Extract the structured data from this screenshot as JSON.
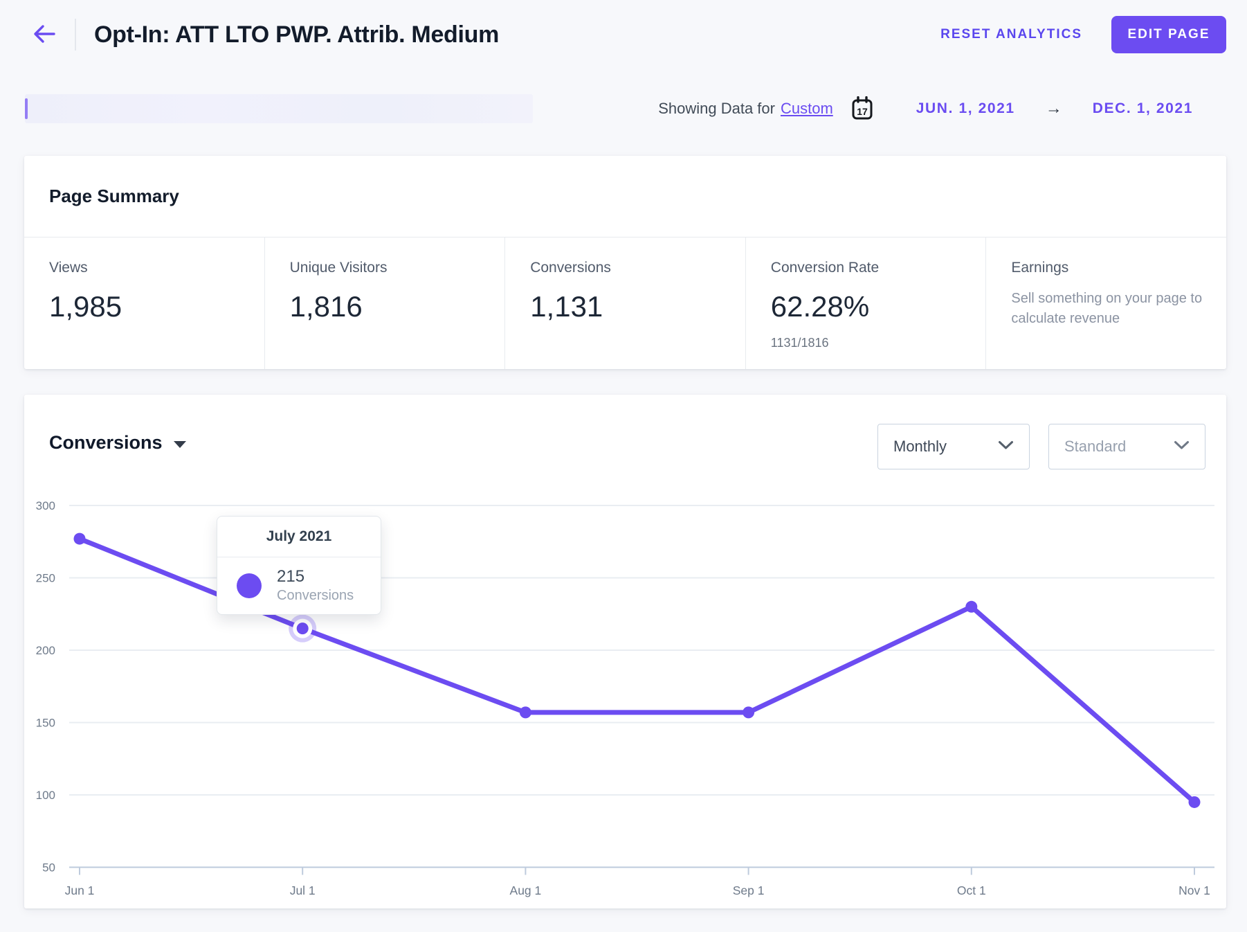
{
  "colors": {
    "accent": "#6C4CF1",
    "reset_link": "#5A46EE",
    "grid_line": "#e9edf2",
    "axis_line": "#becbdd",
    "axis_label": "#6e7a8a"
  },
  "header": {
    "title": "Opt-In: ATT LTO PWP. Attrib. Medium",
    "reset_label": "RESET ANALYTICS",
    "edit_label": "EDIT PAGE"
  },
  "date_bar": {
    "prefix": "Showing Data for",
    "mode_link": "Custom",
    "calendar_day": "17",
    "start_date": "JUN. 1, 2021",
    "arrow": "→",
    "end_date": "DEC. 1, 2021"
  },
  "page_summary": {
    "title": "Page Summary",
    "stats": [
      {
        "label": "Views",
        "value": "1,985"
      },
      {
        "label": "Unique Visitors",
        "value": "1,816"
      },
      {
        "label": "Conversions",
        "value": "1,131"
      },
      {
        "label": "Conversion Rate",
        "value": "62.28%",
        "sub": "1131/1816"
      },
      {
        "label": "Earnings",
        "description": "Sell something on your page to calculate revenue"
      }
    ]
  },
  "chart_section": {
    "title": "Conversions",
    "interval_dropdown": {
      "value": "Monthly"
    },
    "view_dropdown": {
      "value": "Standard"
    }
  },
  "tooltip": {
    "title": "July 2021",
    "value": "215",
    "label": "Conversions"
  },
  "chart_data": {
    "type": "line",
    "title": "Conversions",
    "categories": [
      "Jun 1",
      "Jul 1",
      "Aug 1",
      "Sep 1",
      "Oct 1",
      "Nov 1"
    ],
    "series": [
      {
        "name": "Conversions",
        "values": [
          277,
          215,
          157,
          157,
          230,
          95
        ]
      }
    ],
    "xlabel": "",
    "ylabel": "",
    "ylim": [
      50,
      300
    ],
    "yticks": [
      50,
      100,
      150,
      200,
      250,
      300
    ],
    "grid": true,
    "legend": false,
    "line_color": "#6C4CF1",
    "highlight": {
      "index": 1,
      "period": "July 2021",
      "value": 215
    }
  }
}
